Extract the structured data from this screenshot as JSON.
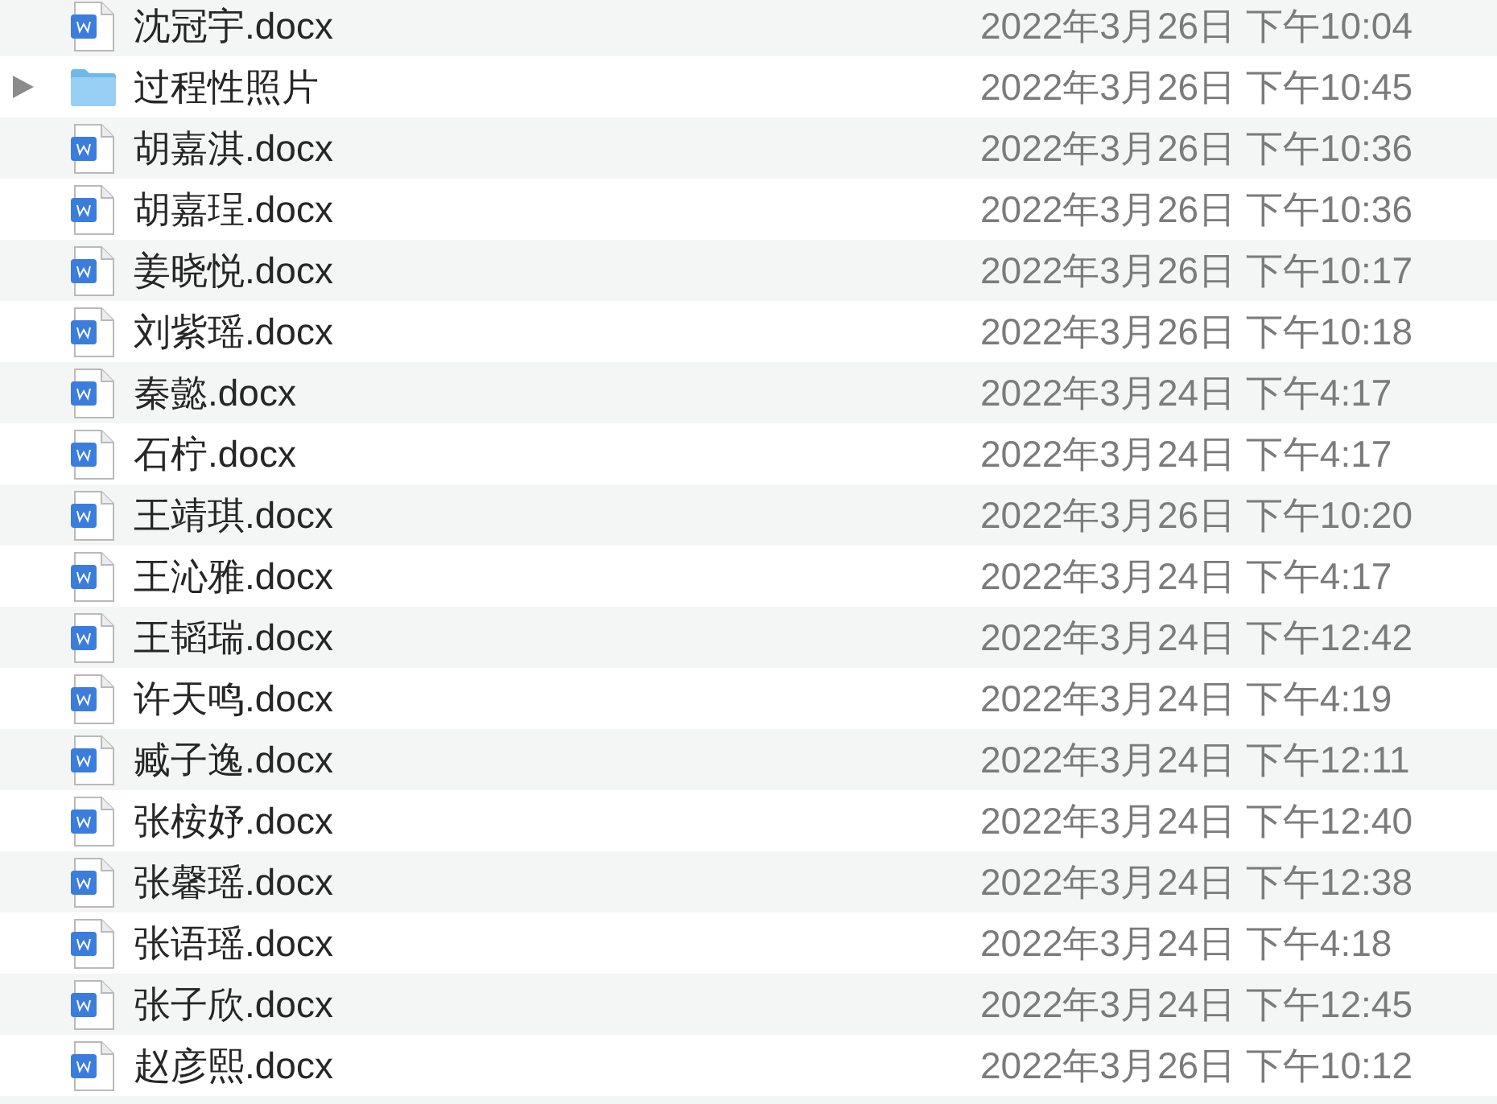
{
  "files": [
    {
      "kind": "document",
      "name": "沈冠宇.docx",
      "modified": "2022年3月26日 下午10:04"
    },
    {
      "kind": "folder",
      "expanded": false,
      "name": "过程性照片",
      "modified": "2022年3月26日 下午10:45"
    },
    {
      "kind": "document",
      "name": "胡嘉淇.docx",
      "modified": "2022年3月26日 下午10:36"
    },
    {
      "kind": "document",
      "name": "胡嘉珵.docx",
      "modified": "2022年3月26日 下午10:36"
    },
    {
      "kind": "document",
      "name": "姜晓悦.docx",
      "modified": "2022年3月26日 下午10:17"
    },
    {
      "kind": "document",
      "name": "刘紫瑶.docx",
      "modified": "2022年3月26日 下午10:18"
    },
    {
      "kind": "document",
      "name": "秦懿.docx",
      "modified": "2022年3月24日 下午4:17"
    },
    {
      "kind": "document",
      "name": "石柠.docx",
      "modified": "2022年3月24日 下午4:17"
    },
    {
      "kind": "document",
      "name": "王靖琪.docx",
      "modified": "2022年3月26日 下午10:20"
    },
    {
      "kind": "document",
      "name": "王沁雅.docx",
      "modified": "2022年3月24日 下午4:17"
    },
    {
      "kind": "document",
      "name": "王韬瑞.docx",
      "modified": "2022年3月24日 下午12:42"
    },
    {
      "kind": "document",
      "name": "许天鸣.docx",
      "modified": "2022年3月24日 下午4:19"
    },
    {
      "kind": "document",
      "name": "臧子逸.docx",
      "modified": "2022年3月24日 下午12:11"
    },
    {
      "kind": "document",
      "name": "张桉妤.docx",
      "modified": "2022年3月24日 下午12:40"
    },
    {
      "kind": "document",
      "name": "张馨瑶.docx",
      "modified": "2022年3月24日 下午12:38"
    },
    {
      "kind": "document",
      "name": "张语瑶.docx",
      "modified": "2022年3月24日 下午4:18"
    },
    {
      "kind": "document",
      "name": "张子欣.docx",
      "modified": "2022年3月24日 下午12:45"
    },
    {
      "kind": "document",
      "name": "赵彦熙.docx",
      "modified": "2022年3月26日 下午10:12"
    }
  ]
}
